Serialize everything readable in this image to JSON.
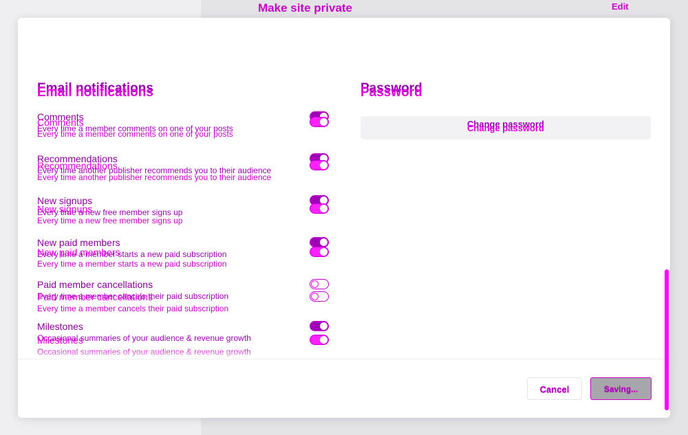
{
  "background": {
    "title": "Make site private",
    "edit_label": "Edit",
    "bottom_text": ""
  },
  "email_notifications": {
    "title": "Email notifications",
    "items": [
      {
        "label": "Comments",
        "desc": "Every time a member comments on one of your posts",
        "enabled": true
      },
      {
        "label": "Recommendations",
        "desc": "Every time another publisher recommends you to their audience",
        "enabled": true
      },
      {
        "label": "New signups",
        "desc": "Every time a new free member signs up",
        "enabled": true
      },
      {
        "label": "New paid members",
        "desc": "Every time a member starts a new paid subscription",
        "enabled": true
      },
      {
        "label": "Paid member cancellations",
        "desc": "Every time a member cancels their paid subscription",
        "enabled": false
      },
      {
        "label": "Milestones",
        "desc": "Occasional summaries of your audience & revenue growth",
        "enabled": true
      }
    ]
  },
  "password": {
    "title": "Password",
    "change_label": "Change password"
  },
  "footer": {
    "cancel_label": "Cancel",
    "save_label": "Saving..."
  },
  "colors": {
    "accent": "#a000b8",
    "ghost": "#ff00ff",
    "save_bg": "#a7a7ab"
  }
}
